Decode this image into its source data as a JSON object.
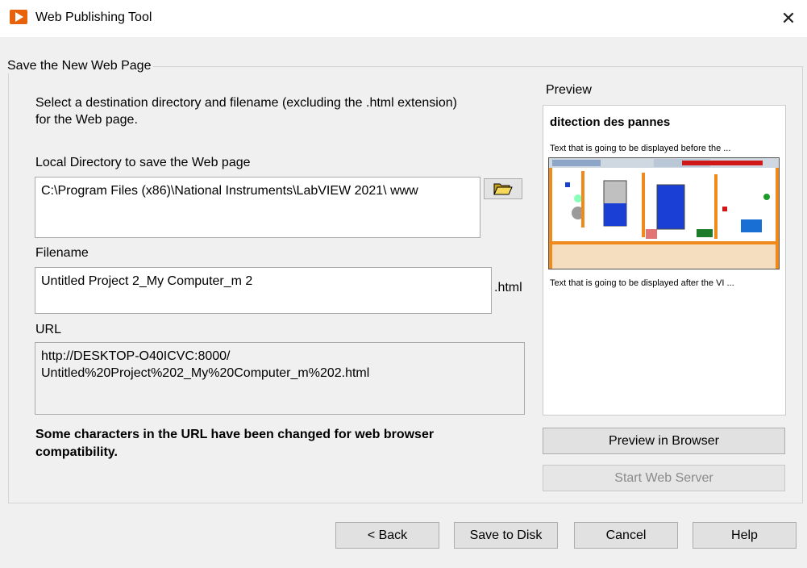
{
  "window": {
    "title": "Web Publishing Tool",
    "close_glyph": "✕"
  },
  "group": {
    "legend": "Save the New Web Page"
  },
  "instructions": "Select a destination directory and filename (excluding the .html extension) for the Web page.",
  "local_directory": {
    "label": "Local Directory to save the Web page",
    "value": "C:\\Program Files (x86)\\National Instruments\\LabVIEW 2021\\ www",
    "icon": "folder-open-icon"
  },
  "filename": {
    "label": "Filename",
    "value": "Untitled Project 2_My Computer_m 2",
    "suffix": ".html"
  },
  "url": {
    "label": "URL",
    "value": "http://DESKTOP-O40ICVC:8000/ Untitled%20Project%202_My%20Computer_m%202.html"
  },
  "warning": "Some characters in the URL have been changed for web browser compatibility.",
  "preview": {
    "label": "Preview",
    "page_title": "ditection des pannes",
    "text_before": "Text that is going to be displayed before the ...",
    "text_after": "Text that is going to be displayed after the VI ..."
  },
  "buttons": {
    "preview_in_browser": "Preview in Browser",
    "start_web_server": "Start Web Server",
    "back": "< Back",
    "save_to_disk": "Save to Disk",
    "cancel": "Cancel",
    "help": "Help"
  },
  "colors": {
    "app_icon": "#e8620c",
    "diagram_tank": "#1a3fd4",
    "diagram_pipe": "#f08a1c"
  }
}
